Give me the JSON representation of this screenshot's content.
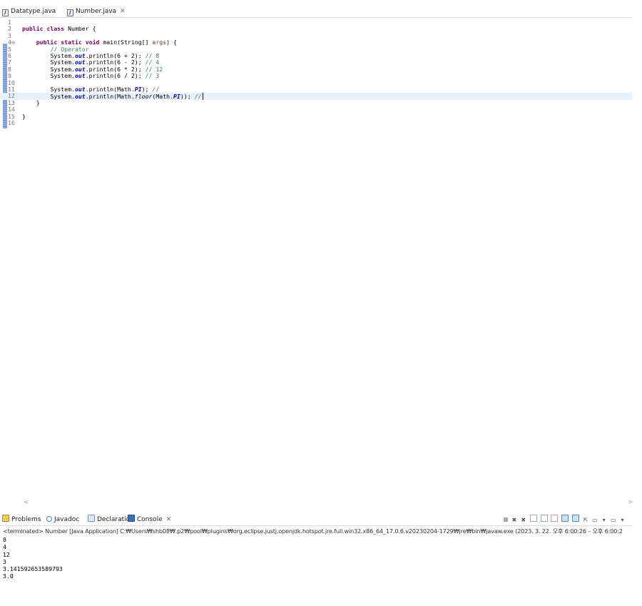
{
  "editor_tabs": [
    {
      "label": "Datatype.java",
      "active": false
    },
    {
      "label": "Number.java",
      "active": true
    }
  ],
  "editor": {
    "line_numbers": [
      "1",
      "2",
      "3",
      "4",
      "5",
      "6",
      "7",
      "8",
      "9",
      "10",
      "11",
      "12",
      "13",
      "14",
      "15",
      "16"
    ],
    "code": {
      "l2_kw": "public class",
      "l2_rest": " Number {",
      "l4_kw": "public static void",
      "l4_rest": " main(String[] ",
      "l4_args": "args",
      "l4_end": ") {",
      "l5_comment": "// Operator",
      "system_out": "System.",
      "out": "out",
      "l6_rest": ".println(6 + 2); ",
      "l6_comment": "// 8",
      "l7_rest": ".println(6 - 2); ",
      "l7_comment": "// 4",
      "l8_rest": ".println(6 * 2); ",
      "l8_comment": "// 12",
      "l9_rest": ".println(6 / 2); ",
      "l9_comment": "// 3",
      "l11_a": ".println(Math.",
      "pi": "PI",
      "l11_b": "); ",
      "l11_comment": "//",
      "l12_a": ".println(Math.",
      "floor": "floor",
      "l12_b": "(Math.",
      "l12_c": ")); ",
      "l12_comment": "//",
      "close_brace": "}"
    }
  },
  "panel": {
    "tabs": [
      "Problems",
      "Javadoc",
      "Declaration",
      "Console"
    ],
    "status": "<terminated> Number [Java Application] C:₩Users₩shb08₩.p2₩pool₩plugins₩org.eclipse.justj.openjdk.hotspot.jre.full.win32.x86_64_17.0.6.v20230204-1729₩jre₩bin₩javaw.exe  (2023. 3. 22. 오후 6:00:26 – 오후 6:00:2",
    "output": [
      "8",
      "4",
      "12",
      "3",
      "3.141592653589793",
      "3.0"
    ]
  },
  "icons": {
    "java_file": "java-file-icon",
    "close": "close-icon",
    "problems": "problems-icon",
    "javadoc": "javadoc-icon",
    "declaration": "declaration-icon",
    "console": "console-icon"
  }
}
